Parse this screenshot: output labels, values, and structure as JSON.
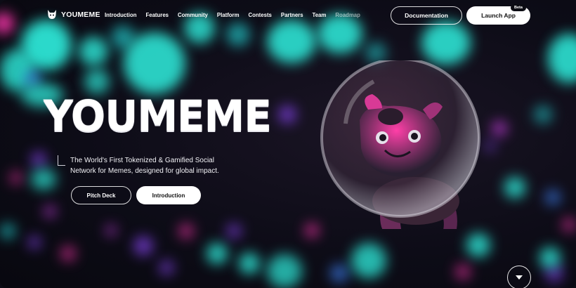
{
  "brand": {
    "name": "YOUMEME"
  },
  "nav": {
    "items": [
      {
        "label": "Introduction"
      },
      {
        "label": "Features"
      },
      {
        "label": "Community"
      },
      {
        "label": "Platform"
      },
      {
        "label": "Contests"
      },
      {
        "label": "Partners"
      },
      {
        "label": "Team"
      },
      {
        "label": "Roadmap"
      }
    ],
    "documentation_label": "Documentation",
    "launch_label": "Launch App",
    "beta_badge": "Beta"
  },
  "hero": {
    "title": "YOUMEME",
    "tagline_line1": "The World's First Tokenized & Gamified Social",
    "tagline_line2": "Network for Memes, designed for global impact.",
    "pitch_label": "Pitch Deck",
    "intro_label": "Introduction"
  },
  "icons": {
    "logo": "dog-logo-icon",
    "scroll": "chevron-down-icon"
  },
  "colors": {
    "background": "#0c0c16",
    "accent_cyan": "#2ff0df",
    "accent_pink": "#e0309a",
    "button_white": "#ffffff"
  }
}
